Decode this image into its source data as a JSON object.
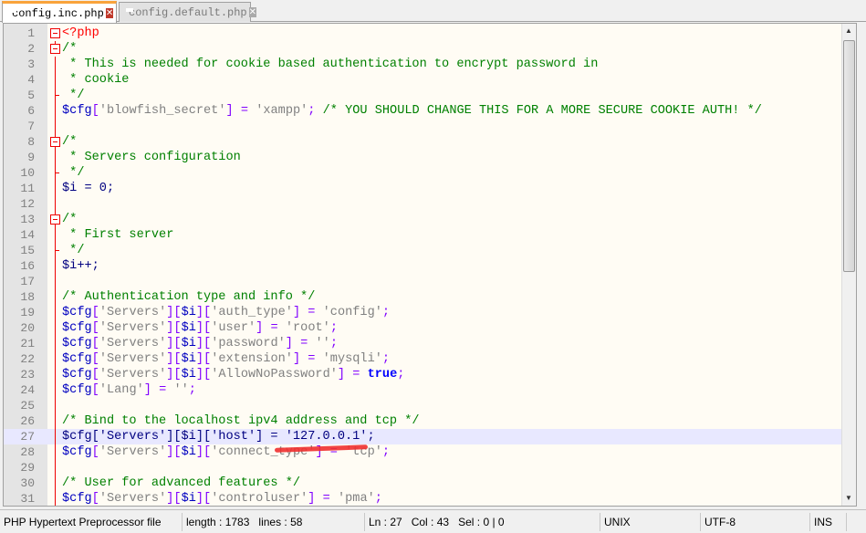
{
  "tabs": [
    {
      "label": "config.inc.php",
      "active": true
    },
    {
      "label": "config.default.php",
      "active": false
    }
  ],
  "editor": {
    "current_line": 27,
    "lines": [
      "<?php",
      "/*",
      " * This is needed for cookie based authentication to encrypt password in",
      " * cookie",
      " */",
      "$cfg['blowfish_secret'] = 'xampp'; /* YOU SHOULD CHANGE THIS FOR A MORE SECURE COOKIE AUTH! */",
      "",
      "/*",
      " * Servers configuration",
      " */",
      "$i = 0;",
      "",
      "/*",
      " * First server",
      " */",
      "$i++;",
      "",
      "/* Authentication type and info */",
      "$cfg['Servers'][$i]['auth_type'] = 'config';",
      "$cfg['Servers'][$i]['user'] = 'root';",
      "$cfg['Servers'][$i]['password'] = '';",
      "$cfg['Servers'][$i]['extension'] = 'mysqli';",
      "$cfg['Servers'][$i]['AllowNoPassword'] = true;",
      "$cfg['Lang'] = '';",
      "",
      "/* Bind to the localhost ipv4 address and tcp */",
      "$cfg['Servers'][$i]['host'] = '127.0.0.1';",
      "$cfg['Servers'][$i]['connect_type'] = 'tcp';",
      "",
      "/* User for advanced features */",
      "$cfg['Servers'][$i]['controluser'] = 'pma';"
    ]
  },
  "colors": {
    "comment": "#008000",
    "variable": "#0000c0",
    "string": "#808080",
    "operator": "#8000ff",
    "number": "#ff0000",
    "annotation": "#f03030"
  },
  "status": {
    "file_type": "PHP Hypertext Preprocessor file",
    "length": "length : 1783",
    "lines": "lines : 58",
    "ln": "Ln : 27",
    "col": "Col : 43",
    "sel": "Sel : 0 | 0",
    "eol": "UNIX",
    "encoding": "UTF-8",
    "mode": "INS"
  }
}
